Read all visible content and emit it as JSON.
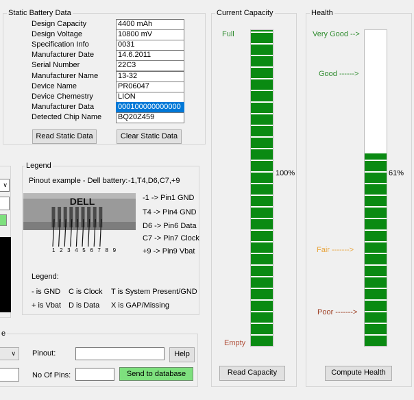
{
  "static_battery": {
    "title": "Static Battery Data",
    "rows": [
      {
        "label": "Design Capacity",
        "value": "4400 mAh"
      },
      {
        "label": "Design Voltage",
        "value": "10800 mV"
      },
      {
        "label": "Specification Info",
        "value": "0031"
      },
      {
        "label": "Manufacturer Date",
        "value": "14.6.2011"
      },
      {
        "label": "Serial Number",
        "value": "22C3"
      },
      {
        "label": "Manufacturer Name",
        "value": "13-32"
      },
      {
        "label": "Device Name",
        "value": "PR06047"
      },
      {
        "label": "Device Chemestry",
        "value": "LION"
      },
      {
        "label": "Manufacturer Data",
        "value": "000100000000000"
      },
      {
        "label": "Detected Chip Name",
        "value": "BQ20Z459"
      }
    ],
    "read_button": "Read Static Data",
    "clear_button": "Clear Static Data"
  },
  "legend": {
    "title": "Legend",
    "pinout_example_label": "Pinout example - Dell battery:",
    "pinout_example_value": "-1,T4,D6,C7,+9",
    "connector_brand": "DELL",
    "pin_numbers": "1 2 3 4 5 6 7 8 9",
    "mappings": [
      "-1 -> Pin1 GND",
      "T4 -> Pin4 GND",
      "D6 -> Pin6 Data",
      "C7 -> Pin7 Clock",
      "+9 -> Pin9 Vbat"
    ],
    "sub_title": "Legend:",
    "keys_row1": [
      "- is GND",
      "C is Clock",
      "T is System Present/GND"
    ],
    "keys_row2": [
      "+ is Vbat",
      "D is Data",
      "X is GAP/Missing"
    ]
  },
  "database": {
    "title_fragment": "e",
    "pinout_label": "Pinout:",
    "pinout_value": "",
    "help_button": "Help",
    "pins_label": "No Of Pins:",
    "pins_value": "",
    "send_button": "Send to database"
  },
  "current_capacity": {
    "title": "Current Capacity",
    "full_label": "Full",
    "empty_label": "Empty",
    "percent_text": "100%",
    "level_fraction": 1.0,
    "read_button": "Read Capacity"
  },
  "health": {
    "title": "Health",
    "very_good_label": "Very Good -->",
    "good_label": "Good ------>",
    "fair_label": "Fair ------->",
    "poor_label": "Poor ------->",
    "percent_text": "61%",
    "level_fraction": 0.61,
    "compute_button": "Compute Health"
  },
  "colors": {
    "bar_green": "#0a8a12",
    "full_label": "#2e8b2e",
    "good_label": "#2e8b2e",
    "fair_label": "#e8a33a",
    "poor_label": "#9b3a1e",
    "empty_label": "#b0503a",
    "send_button_bg": "#7ee07e"
  }
}
